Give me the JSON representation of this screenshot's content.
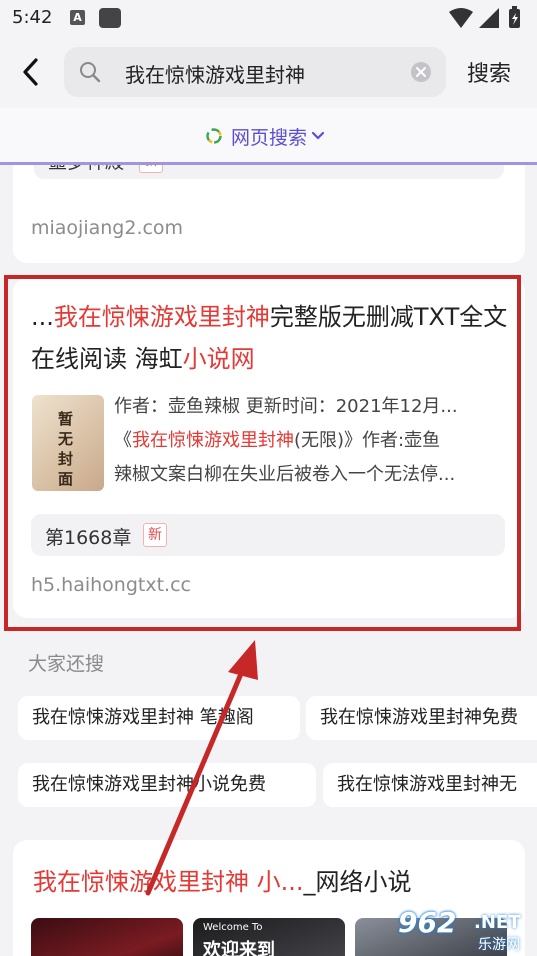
{
  "status_bar": {
    "time": "5:42",
    "a_icon_letter": "A"
  },
  "search": {
    "query": "我在惊悚游戏里封神",
    "button_label": "搜索"
  },
  "filter": {
    "label": "网页搜索"
  },
  "top_card": {
    "tag": "噩梦神殿",
    "new_label": "新",
    "url": "miaojiang2.com"
  },
  "main_card": {
    "title_prefix": "...",
    "title_highlight": "我在惊悚游戏里封神",
    "title_mid": "完整版无删减TXT全文在线阅读 海虹",
    "title_highlight2": "小说网",
    "thumb_text": "暂无封面",
    "author_line": "作者：壶鱼辣椒  更新时间：2021年12月...",
    "desc_open": "《",
    "desc_highlight": "我在惊悚游戏里封神",
    "desc_rest": "(无限)》作者:壶鱼",
    "desc_line2": "辣椒文案白柳在失业后被卷入一个无法停...",
    "chapter": "第1668章",
    "new_label": "新",
    "url": "h5.haihongtxt.cc"
  },
  "also_search": {
    "title": "大家还搜",
    "chips": [
      "我在惊悚游戏里封神 笔趣阁",
      "我在惊悚游戏里封神免费",
      "我在惊悚游戏里封神小说免费",
      "我在惊悚游戏里封神无"
    ]
  },
  "bottom_card": {
    "title_highlight": "我在惊悚游戏里封神 小...",
    "title_rest": "_网络小说",
    "thumb2_text": "欢迎来到",
    "thumb2_small": "Welcome To"
  },
  "watermark": {
    "num": "962",
    "net": ".NET",
    "sub": "乐游网"
  },
  "colors": {
    "accent": "#5b4ed4",
    "highlight": "#e53935",
    "frame": "#c62828"
  }
}
